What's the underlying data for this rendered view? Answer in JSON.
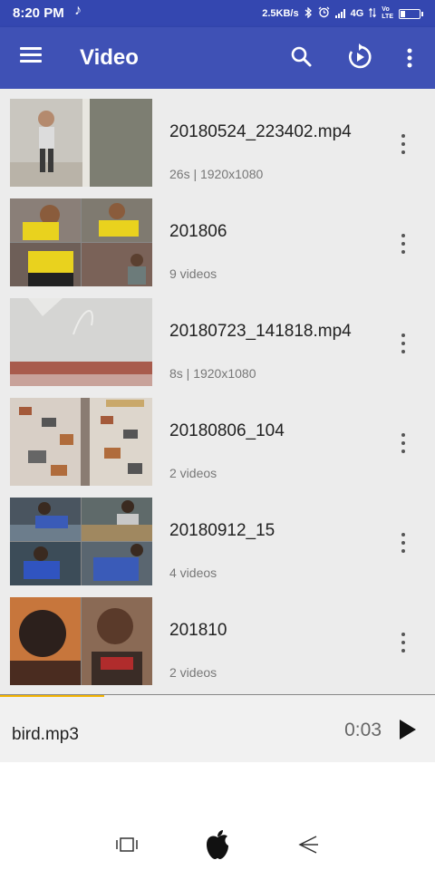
{
  "status_bar": {
    "time": "8:20 PM",
    "music_icon": "music-note-icon",
    "net_speed": "2.5KB/s",
    "network": "4G",
    "volte_top": "Vo",
    "volte_bottom": "LTE",
    "battery_level": 0.3
  },
  "app_bar": {
    "title": "Video",
    "icons": [
      "menu-icon",
      "search-icon",
      "replay-icon",
      "more-vert-icon"
    ]
  },
  "items": [
    {
      "title": "20180524_223402.mp4",
      "subtitle": "26s | 1920x1080"
    },
    {
      "title": "201806",
      "subtitle": "9 videos"
    },
    {
      "title": "20180723_141818.mp4",
      "subtitle": "8s | 1920x1080"
    },
    {
      "title": "20180806_104",
      "subtitle": "2 videos"
    },
    {
      "title": "20180912_15",
      "subtitle": "4 videos"
    },
    {
      "title": "201810",
      "subtitle": "2 videos"
    }
  ],
  "player": {
    "track": "bird.mp3",
    "time": "0:03",
    "progress": 0.24
  },
  "nav_bar": {
    "icons": [
      "recents-icon",
      "home-apple-icon",
      "back-icon"
    ]
  },
  "colors": {
    "app_bar": "#3f51b5",
    "status_bar": "#3447b0",
    "progress": "#f3b300",
    "list_bg": "#ececec"
  }
}
